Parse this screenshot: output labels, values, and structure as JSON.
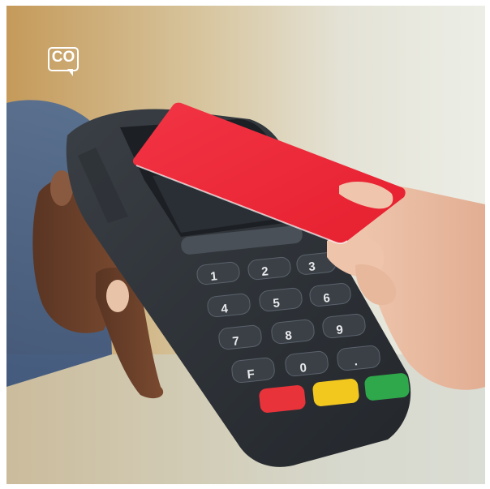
{
  "image": {
    "subject": "Contactless payment: a red card held over a card payment terminal"
  },
  "brand_badge": {
    "text": "CO",
    "icon": "speech-bubble-logo-icon",
    "color": "#ffffff"
  },
  "terminal": {
    "keypad_keys": [
      "1",
      "2",
      "3",
      "4",
      "5",
      "6",
      "7",
      "8",
      "9",
      "F",
      "0",
      "."
    ],
    "function_key_colors": {
      "cancel": "#e8333a",
      "clear": "#f2c81f",
      "enter": "#2ea84a"
    }
  },
  "card": {
    "color": "#ef2d3c"
  }
}
